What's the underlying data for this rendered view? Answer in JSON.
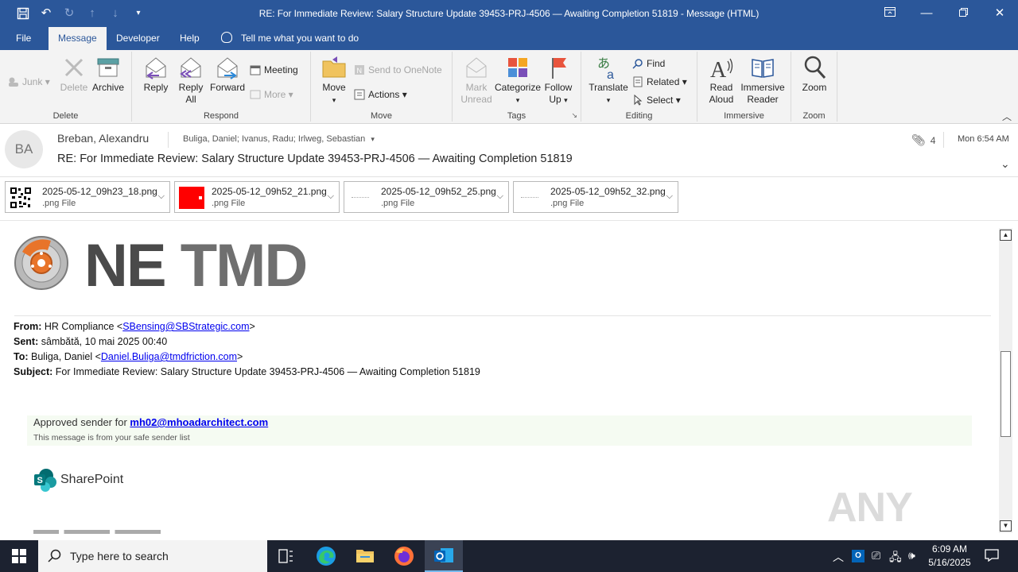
{
  "window": {
    "title": "RE: For Immediate Review: Salary Structure Update 39453-PRJ-4506 — Awaiting Completion 51819  -  Message (HTML)"
  },
  "menu": {
    "tabs": [
      "File",
      "Message",
      "Developer",
      "Help"
    ],
    "active": "Message",
    "tell_me": "Tell me what you want to do"
  },
  "ribbon": {
    "delete_group": {
      "label": "Delete",
      "junk": "Junk",
      "delete": "Delete",
      "archive": "Archive"
    },
    "respond_group": {
      "label": "Respond",
      "reply": "Reply",
      "reply_all_1": "Reply",
      "reply_all_2": "All",
      "forward": "Forward",
      "meeting": "Meeting",
      "more": "More"
    },
    "move_group": {
      "label": "Move",
      "move": "Move",
      "onenote": "Send to OneNote",
      "actions": "Actions"
    },
    "tags_group": {
      "label": "Tags",
      "mark_1": "Mark",
      "mark_2": "Unread",
      "categorize": "Categorize",
      "follow_1": "Follow",
      "follow_2": "Up"
    },
    "editing_group": {
      "label": "Editing",
      "translate": "Translate",
      "find": "Find",
      "related": "Related",
      "select": "Select"
    },
    "immersive_group": {
      "label": "Immersive",
      "read_1": "Read",
      "read_2": "Aloud",
      "imm_1": "Immersive",
      "imm_2": "Reader"
    },
    "zoom_group": {
      "label": "Zoom",
      "zoom": "Zoom"
    }
  },
  "message": {
    "avatar_initials": "BA",
    "sender": "Breban, Alexandru",
    "recipients": "Buliga, Daniel; Ivanus, Radu; Irlweg, Sebastian",
    "subject": "RE: For Immediate Review: Salary Structure Update 39453-PRJ-4506 — Awaiting Completion 51819",
    "attachment_count": "4",
    "date": "Mon 6:54 AM"
  },
  "attachments": [
    {
      "name": "2025-05-12_09h23_18.png",
      "type": ".png File",
      "thumb": "qr-code"
    },
    {
      "name": "2025-05-12_09h52_21.png",
      "type": ".png File",
      "thumb": "red-image"
    },
    {
      "name": "2025-05-12_09h52_25.png",
      "type": ".png File",
      "thumb": "blank-image"
    },
    {
      "name": "2025-05-12_09h52_32.png",
      "type": ".png File",
      "thumb": "blank-image"
    }
  ],
  "body": {
    "logo_text_1": "NE",
    "logo_text_2": "TMD",
    "from_label": "From:",
    "from_name": "HR Compliance <",
    "from_email": "SBensing@SBStrategic.com",
    "sent_label": "Sent:",
    "sent_value": "sâmbătă, 10 mai 2025 00:40",
    "to_label": "To:",
    "to_name": "Buliga, Daniel <",
    "to_email": "Daniel.Buliga@tmdfriction.com",
    "subject_label": "Subject:",
    "subject_value": "For Immediate Review: Salary Structure Update 39453-PRJ-4506  — Awaiting Completion 51819",
    "safe_prefix": "Approved sender for ",
    "safe_email": "mh02@mhoadarchitect.com",
    "safe_note": "This message is from your safe sender list",
    "sharepoint": "SharePoint",
    "watermark": "ANY RUN"
  },
  "taskbar": {
    "search_placeholder": "Type here to search",
    "time": "6:09 AM",
    "date": "5/16/2025"
  },
  "colors": {
    "title_bar": "#2b579a",
    "ribbon": "#f3f3f3",
    "taskbar": "#1c2230",
    "link": "#0000ee",
    "sharepoint": "#03787c"
  }
}
